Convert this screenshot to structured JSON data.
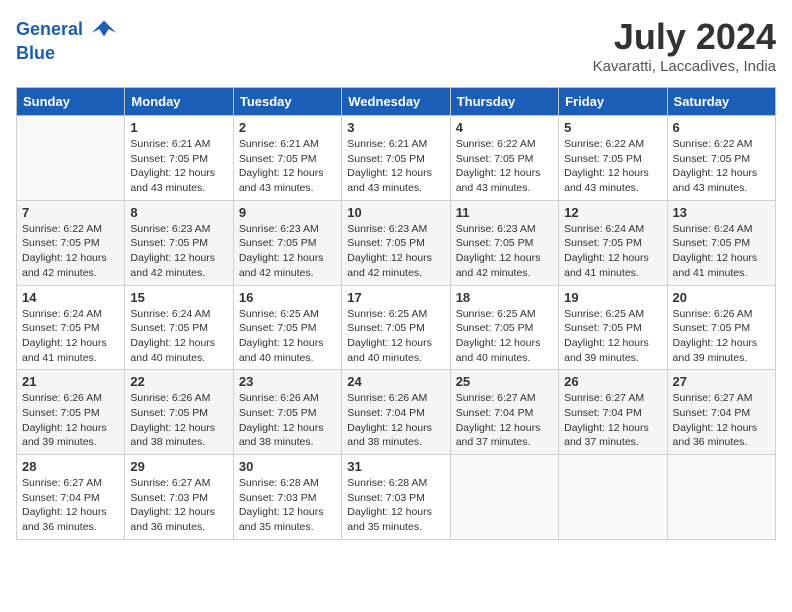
{
  "header": {
    "logo_line1": "General",
    "logo_line2": "Blue",
    "month": "July 2024",
    "location": "Kavaratti, Laccadives, India"
  },
  "columns": [
    "Sunday",
    "Monday",
    "Tuesday",
    "Wednesday",
    "Thursday",
    "Friday",
    "Saturday"
  ],
  "weeks": [
    [
      {
        "day": "",
        "info": ""
      },
      {
        "day": "1",
        "info": "Sunrise: 6:21 AM\nSunset: 7:05 PM\nDaylight: 12 hours\nand 43 minutes."
      },
      {
        "day": "2",
        "info": "Sunrise: 6:21 AM\nSunset: 7:05 PM\nDaylight: 12 hours\nand 43 minutes."
      },
      {
        "day": "3",
        "info": "Sunrise: 6:21 AM\nSunset: 7:05 PM\nDaylight: 12 hours\nand 43 minutes."
      },
      {
        "day": "4",
        "info": "Sunrise: 6:22 AM\nSunset: 7:05 PM\nDaylight: 12 hours\nand 43 minutes."
      },
      {
        "day": "5",
        "info": "Sunrise: 6:22 AM\nSunset: 7:05 PM\nDaylight: 12 hours\nand 43 minutes."
      },
      {
        "day": "6",
        "info": "Sunrise: 6:22 AM\nSunset: 7:05 PM\nDaylight: 12 hours\nand 43 minutes."
      }
    ],
    [
      {
        "day": "7",
        "info": "Sunrise: 6:22 AM\nSunset: 7:05 PM\nDaylight: 12 hours\nand 42 minutes."
      },
      {
        "day": "8",
        "info": "Sunrise: 6:23 AM\nSunset: 7:05 PM\nDaylight: 12 hours\nand 42 minutes."
      },
      {
        "day": "9",
        "info": "Sunrise: 6:23 AM\nSunset: 7:05 PM\nDaylight: 12 hours\nand 42 minutes."
      },
      {
        "day": "10",
        "info": "Sunrise: 6:23 AM\nSunset: 7:05 PM\nDaylight: 12 hours\nand 42 minutes."
      },
      {
        "day": "11",
        "info": "Sunrise: 6:23 AM\nSunset: 7:05 PM\nDaylight: 12 hours\nand 42 minutes."
      },
      {
        "day": "12",
        "info": "Sunrise: 6:24 AM\nSunset: 7:05 PM\nDaylight: 12 hours\nand 41 minutes."
      },
      {
        "day": "13",
        "info": "Sunrise: 6:24 AM\nSunset: 7:05 PM\nDaylight: 12 hours\nand 41 minutes."
      }
    ],
    [
      {
        "day": "14",
        "info": "Sunrise: 6:24 AM\nSunset: 7:05 PM\nDaylight: 12 hours\nand 41 minutes."
      },
      {
        "day": "15",
        "info": "Sunrise: 6:24 AM\nSunset: 7:05 PM\nDaylight: 12 hours\nand 40 minutes."
      },
      {
        "day": "16",
        "info": "Sunrise: 6:25 AM\nSunset: 7:05 PM\nDaylight: 12 hours\nand 40 minutes."
      },
      {
        "day": "17",
        "info": "Sunrise: 6:25 AM\nSunset: 7:05 PM\nDaylight: 12 hours\nand 40 minutes."
      },
      {
        "day": "18",
        "info": "Sunrise: 6:25 AM\nSunset: 7:05 PM\nDaylight: 12 hours\nand 40 minutes."
      },
      {
        "day": "19",
        "info": "Sunrise: 6:25 AM\nSunset: 7:05 PM\nDaylight: 12 hours\nand 39 minutes."
      },
      {
        "day": "20",
        "info": "Sunrise: 6:26 AM\nSunset: 7:05 PM\nDaylight: 12 hours\nand 39 minutes."
      }
    ],
    [
      {
        "day": "21",
        "info": "Sunrise: 6:26 AM\nSunset: 7:05 PM\nDaylight: 12 hours\nand 39 minutes."
      },
      {
        "day": "22",
        "info": "Sunrise: 6:26 AM\nSunset: 7:05 PM\nDaylight: 12 hours\nand 38 minutes."
      },
      {
        "day": "23",
        "info": "Sunrise: 6:26 AM\nSunset: 7:05 PM\nDaylight: 12 hours\nand 38 minutes."
      },
      {
        "day": "24",
        "info": "Sunrise: 6:26 AM\nSunset: 7:04 PM\nDaylight: 12 hours\nand 38 minutes."
      },
      {
        "day": "25",
        "info": "Sunrise: 6:27 AM\nSunset: 7:04 PM\nDaylight: 12 hours\nand 37 minutes."
      },
      {
        "day": "26",
        "info": "Sunrise: 6:27 AM\nSunset: 7:04 PM\nDaylight: 12 hours\nand 37 minutes."
      },
      {
        "day": "27",
        "info": "Sunrise: 6:27 AM\nSunset: 7:04 PM\nDaylight: 12 hours\nand 36 minutes."
      }
    ],
    [
      {
        "day": "28",
        "info": "Sunrise: 6:27 AM\nSunset: 7:04 PM\nDaylight: 12 hours\nand 36 minutes."
      },
      {
        "day": "29",
        "info": "Sunrise: 6:27 AM\nSunset: 7:03 PM\nDaylight: 12 hours\nand 36 minutes."
      },
      {
        "day": "30",
        "info": "Sunrise: 6:28 AM\nSunset: 7:03 PM\nDaylight: 12 hours\nand 35 minutes."
      },
      {
        "day": "31",
        "info": "Sunrise: 6:28 AM\nSunset: 7:03 PM\nDaylight: 12 hours\nand 35 minutes."
      },
      {
        "day": "",
        "info": ""
      },
      {
        "day": "",
        "info": ""
      },
      {
        "day": "",
        "info": ""
      }
    ]
  ]
}
